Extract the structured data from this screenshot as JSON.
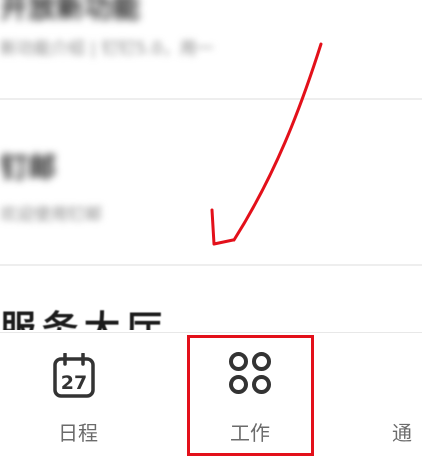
{
  "list": {
    "items": [
      {
        "title": "开放新功能",
        "subtitle": "新功能介绍 | 钉钉5.0，用一"
      },
      {
        "title": "钉邮",
        "subtitle": "欢迎使用钉邮"
      }
    ],
    "partial_title": "服务大厅"
  },
  "tabbar": {
    "tabs": [
      {
        "label": "日程",
        "icon": "calendar-icon",
        "date": "27"
      },
      {
        "label": "工作",
        "icon": "workbench-icon"
      },
      {
        "label": "通",
        "icon": ""
      }
    ]
  },
  "colors": {
    "highlight": "#e3101a",
    "icon": "#333333",
    "label": "#6b6b6b"
  }
}
